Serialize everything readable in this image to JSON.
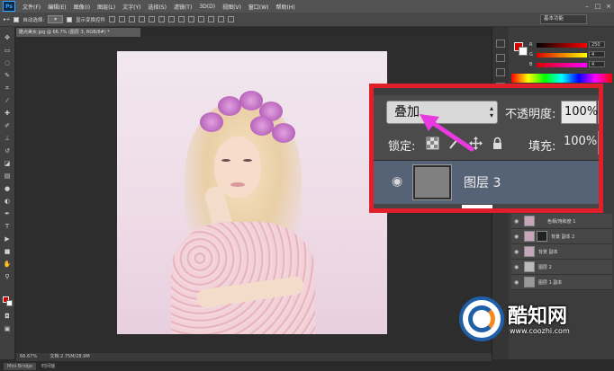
{
  "app": {
    "logo": "Ps"
  },
  "menu": [
    "文件(F)",
    "编辑(E)",
    "图像(I)",
    "图层(L)",
    "文字(Y)",
    "选择(S)",
    "滤镜(T)",
    "3D(D)",
    "视图(V)",
    "窗口(W)",
    "帮助(H)"
  ],
  "window_controls": [
    "–",
    "□",
    "×"
  ],
  "options_bar": {
    "auto_select": "自动选择:",
    "show_transform": "显示变换控件"
  },
  "workspace": "基本功能",
  "document": {
    "tab": "酷点美女.jpg @ 66.7% (图层 3, RGB/8#) *"
  },
  "color_panel": {
    "labels": [
      "R",
      "G",
      "B"
    ],
    "values": [
      "250",
      "4",
      "4"
    ],
    "fg_color": "#d30000",
    "bg_color": "#ffffff"
  },
  "layers_panel": {
    "blend_mode": "叠加",
    "opacity_label": "不透明度:",
    "opacity_value": "100%",
    "lock_label": "锁定:",
    "fill_label": "填充:",
    "fill_value": "100%",
    "active_layer": "图层 3",
    "mini_layers": [
      "色相/饱和度 1",
      "背景 副本 2",
      "背景 副本",
      "图层 2",
      "图层 1 副本"
    ]
  },
  "status": {
    "zoom": "66.67%",
    "doc": "文档:2.75M/28.9M"
  },
  "bottom_tabs": [
    "Mini Bridge",
    "时间轴"
  ],
  "watermark": {
    "name": "酷知网",
    "url": "www.coozhi.com"
  },
  "colors": {
    "callout_border": "#e21e2b",
    "arrow": "#e83adf",
    "selected_layer": "#566275"
  }
}
